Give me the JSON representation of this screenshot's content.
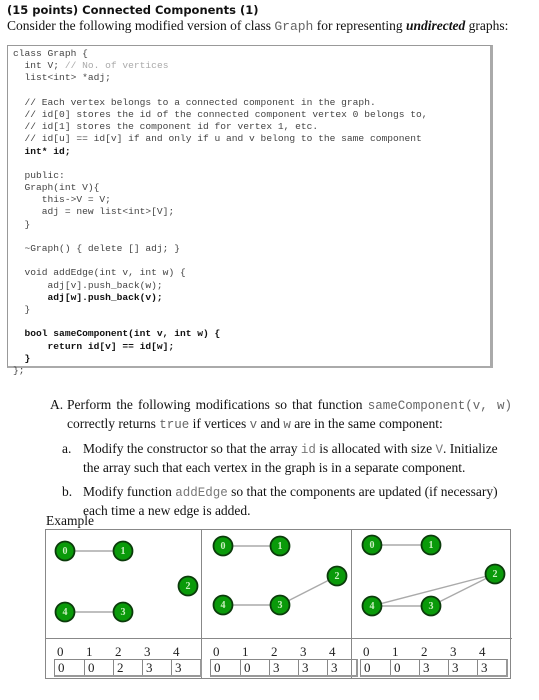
{
  "header": {
    "title": "(15 points) Connected Components (1)",
    "intro_pre": "Consider the following modified version of class ",
    "intro_code": "Graph",
    "intro_mid": " for representing ",
    "intro_em": "undirected",
    "intro_post": " graphs:"
  },
  "code": {
    "lines": [
      {
        "text": "class Graph {",
        "style": "normal"
      },
      {
        "text": "  int V; ",
        "style": "normal",
        "comment": "// No. of vertices"
      },
      {
        "text": "  list<int> *adj;",
        "style": "normal"
      },
      {
        "text": "",
        "style": "normal"
      },
      {
        "text": "  // Each vertex belongs to a connected component in the graph.",
        "style": "normal"
      },
      {
        "text": "  // id[0] stores the id of the connected component vertex 0 belongs to,",
        "style": "normal"
      },
      {
        "text": "  // id[1] stores the component id for vertex 1, etc.",
        "style": "normal"
      },
      {
        "text": "  // id[u] == id[v] if and only if u and v belong to the same component",
        "style": "normal"
      },
      {
        "text": "  int* id;",
        "style": "bold"
      },
      {
        "text": "",
        "style": "normal"
      },
      {
        "text": "  public:",
        "style": "normal"
      },
      {
        "text": "  Graph(int V){",
        "style": "normal"
      },
      {
        "text": "     this->V = V;",
        "style": "normal"
      },
      {
        "text": "     adj = new list<int>[V];",
        "style": "normal"
      },
      {
        "text": "  }",
        "style": "normal"
      },
      {
        "text": "",
        "style": "normal"
      },
      {
        "text": "  ~Graph() { delete [] adj; }",
        "style": "normal"
      },
      {
        "text": "",
        "style": "normal"
      },
      {
        "text": "  void addEdge(int v, int w) {",
        "style": "normal"
      },
      {
        "text": "      adj[v].push_back(w);",
        "style": "normal"
      },
      {
        "text": "      adj[w].push_back(v);",
        "style": "bold"
      },
      {
        "text": "  }",
        "style": "normal"
      },
      {
        "text": "",
        "style": "normal"
      },
      {
        "text": "  bool sameComponent(int v, int w) {",
        "style": "bold"
      },
      {
        "text": "      return id[v] == id[w];",
        "style": "bold"
      },
      {
        "text": "  }",
        "style": "bold"
      },
      {
        "text": "};",
        "style": "normal"
      }
    ]
  },
  "partA": {
    "label": "A.",
    "text_pre": "Perform the following modifications so that function ",
    "code1": "sameComponent(v,  w)",
    "text_mid1": " correctly returns ",
    "code2": "true",
    "text_mid2": " if vertices ",
    "code3": "v",
    "text_mid3": " and ",
    "code4": "w",
    "text_post": " are in the same component:"
  },
  "subA": {
    "label": "a.",
    "text_pre": "Modify the constructor so that the array ",
    "code1": "id",
    "text_mid": " is allocated with size ",
    "code2": "V",
    "text_post": ". Initialize the array such that each vertex in the graph is in a separate component."
  },
  "subB": {
    "label": "b.",
    "text_pre": "Modify function ",
    "code1": "addEdge",
    "text_post": " so that the components are updated (if necessary) each time a new edge is added."
  },
  "example": {
    "label": "Example",
    "node_color": "#0a9a0a",
    "node_border_color": "#0b3b0b",
    "edge_color": "#aaaaaa",
    "graphs": [
      {
        "nodes": [
          "0",
          "1",
          "2",
          "3",
          "4"
        ],
        "edges": [
          [
            "0",
            "1"
          ],
          [
            "4",
            "3"
          ]
        ],
        "indices": [
          "0",
          "1",
          "2",
          "3",
          "4"
        ],
        "ids": [
          "0",
          "0",
          "2",
          "3",
          "3"
        ]
      },
      {
        "nodes": [
          "0",
          "1",
          "2",
          "3",
          "4"
        ],
        "edges": [
          [
            "0",
            "1"
          ],
          [
            "4",
            "3"
          ],
          [
            "3",
            "2"
          ]
        ],
        "indices": [
          "0",
          "1",
          "2",
          "3",
          "4"
        ],
        "ids": [
          "0",
          "0",
          "3",
          "3",
          "3"
        ]
      },
      {
        "nodes": [
          "0",
          "1",
          "2",
          "3",
          "4"
        ],
        "edges": [
          [
            "0",
            "1"
          ],
          [
            "4",
            "3"
          ],
          [
            "3",
            "2"
          ],
          [
            "4",
            "2"
          ]
        ],
        "indices": [
          "0",
          "1",
          "2",
          "3",
          "4"
        ],
        "ids": [
          "0",
          "0",
          "3",
          "3",
          "3"
        ]
      }
    ]
  }
}
